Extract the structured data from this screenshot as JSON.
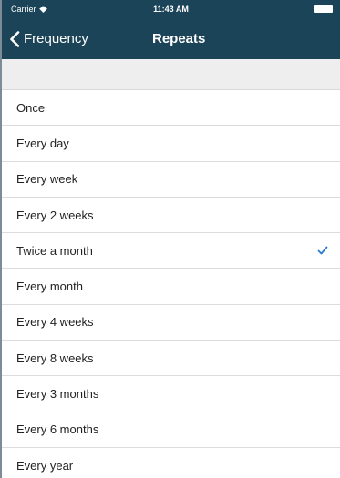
{
  "status_bar": {
    "carrier": "Carrier",
    "time": "11:43 AM",
    "icons": [
      "wifi-icon",
      "battery-icon"
    ]
  },
  "nav": {
    "back_label": "Frequency",
    "title": "Repeats"
  },
  "options": [
    {
      "label": "Once",
      "selected": false
    },
    {
      "label": "Every day",
      "selected": false
    },
    {
      "label": "Every week",
      "selected": false
    },
    {
      "label": "Every 2 weeks",
      "selected": false
    },
    {
      "label": "Twice a month",
      "selected": true
    },
    {
      "label": "Every month",
      "selected": false
    },
    {
      "label": "Every 4 weeks",
      "selected": false
    },
    {
      "label": "Every 8 weeks",
      "selected": false
    },
    {
      "label": "Every 3 months",
      "selected": false
    },
    {
      "label": "Every 6 months",
      "selected": false
    },
    {
      "label": "Every year",
      "selected": false
    }
  ],
  "colors": {
    "bar_background": "#1b4458",
    "checkmark": "#2a7ad3",
    "section_background": "#eeeeee"
  }
}
